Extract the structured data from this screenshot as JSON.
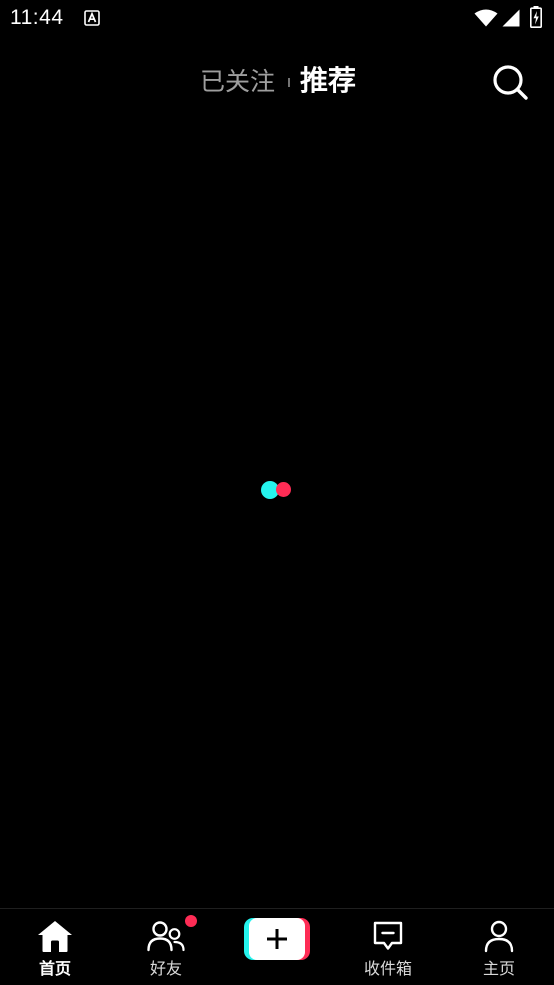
{
  "status_bar": {
    "time": "11:44",
    "icons": [
      "app-notification-icon",
      "wifi-icon",
      "cellular-signal-icon",
      "battery-charging-icon"
    ]
  },
  "top_nav": {
    "tabs": [
      {
        "label": "已关注",
        "active": false
      },
      {
        "label": "推荐",
        "active": true
      }
    ],
    "search_icon": "search-icon"
  },
  "loading": {
    "icon": "loading-dots-icon",
    "colors": {
      "cyan": "#25f4ee",
      "pink": "#fe2c55"
    }
  },
  "bottom_nav": {
    "items": [
      {
        "label": "首页",
        "icon": "home-icon",
        "active": true
      },
      {
        "label": "好友",
        "icon": "friends-icon",
        "active": false,
        "badge": true
      },
      {
        "label": "",
        "icon": "create-plus-icon",
        "active": false
      },
      {
        "label": "收件箱",
        "icon": "inbox-icon",
        "active": false
      },
      {
        "label": "主页",
        "icon": "profile-icon",
        "active": false
      }
    ]
  },
  "colors": {
    "background": "#000000",
    "accent_cyan": "#25f4ee",
    "accent_pink": "#fe2c55",
    "text_primary": "#ffffff"
  }
}
